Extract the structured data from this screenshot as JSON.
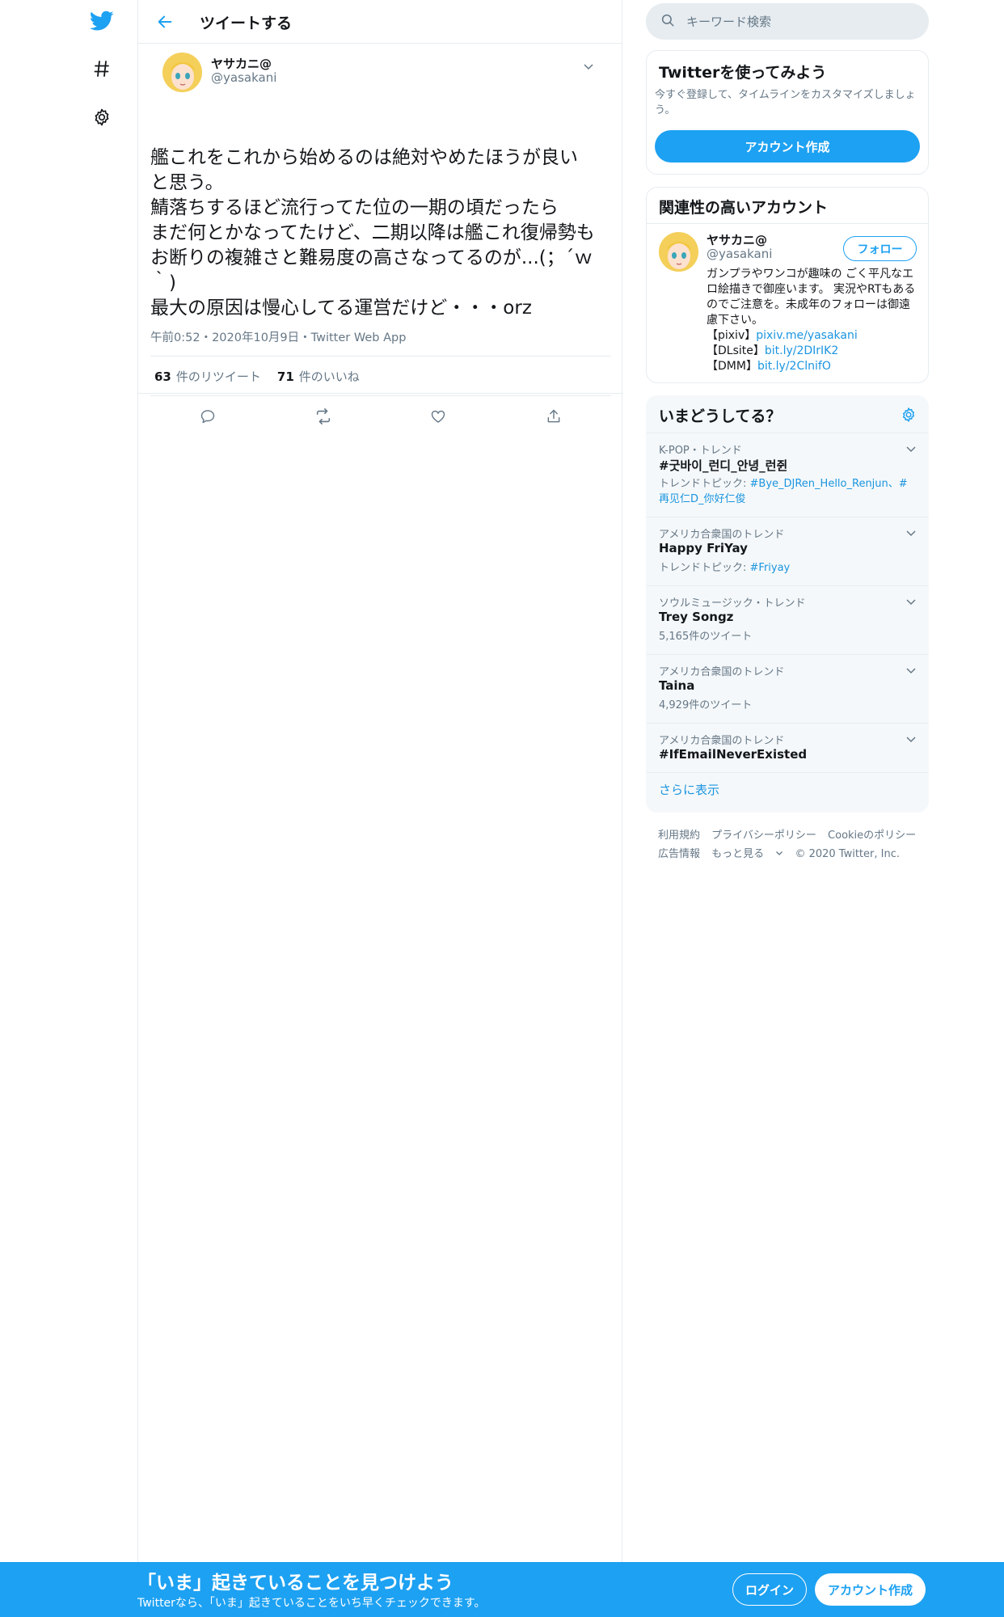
{
  "header": {
    "title": "ツイートする"
  },
  "tweet": {
    "author_name": "ヤサカニ@",
    "author_handle": "@yasakani",
    "lines": [
      "艦これをこれから始めるのは絶対やめたほうが良い",
      "と思う。",
      "鯖落ちするほど流行ってた位の一期の頃だったら",
      "まだ何とかなってたけど、二期以降は艦これ復帰勢も",
      "お断りの複雑さと難易度の高さなってるのが...(；´ｗ",
      "｀)",
      "最大の原因は慢心してる運営だけど・・・orz"
    ],
    "time": "午前0:52",
    "date": "2020年10月9日",
    "source": "Twitter Web App",
    "retweet_count": "63",
    "retweet_label": "件のリツイート",
    "like_count": "71",
    "like_label": "件のいいね"
  },
  "search": {
    "placeholder": "キーワード検索"
  },
  "signup": {
    "title": "Twitterを使ってみよう",
    "description": "今すぐ登録して、タイムラインをカスタマイズしましょう。",
    "button": "アカウント作成"
  },
  "related": {
    "title": "関連性の高いアカウント",
    "name": "ヤサカニ@",
    "handle": "@yasakani",
    "follow_label": "フォロー",
    "bio_text": "ガンプラやワンコが趣味の ごく平凡なエロ絵描きで御座います。 実況やRTもあるのでご注意を。未成年のフォローは御遠慮下さい。",
    "pixiv_label": "【pixiv】",
    "pixiv_link": "pixiv.me/yasakani",
    "dlsite_label": "【DLsite】",
    "dlsite_link": "bit.ly/2DIrIK2",
    "dmm_label": "【DMM】",
    "dmm_link": "bit.ly/2ClnifO"
  },
  "trends": {
    "title": "いまどうしてる？",
    "items": [
      {
        "context": "K-POP・トレンド",
        "name": "#굿바이_런디_안녕_런쥔",
        "sub_prefix": "トレンドトピック: ",
        "sub_links": "#Bye_DJRen_Hello_Renjun、#再见仁D_你好仁俊"
      },
      {
        "context": "アメリカ合衆国のトレンド",
        "name": "Happy FriYay",
        "sub_prefix": "トレンドトピック: ",
        "sub_links": "#Friyay"
      },
      {
        "context": "ソウルミュージック・トレンド",
        "name": "Trey Songz",
        "sub_prefix": "5,165件のツイート",
        "sub_links": ""
      },
      {
        "context": "アメリカ合衆国のトレンド",
        "name": "Taina",
        "sub_prefix": "4,929件のツイート",
        "sub_links": ""
      },
      {
        "context": "アメリカ合衆国のトレンド",
        "name": "#IfEmailNeverExisted",
        "sub_prefix": "",
        "sub_links": ""
      }
    ],
    "show_more": "さらに表示"
  },
  "footer": {
    "terms": "利用規約",
    "privacy": "プライバシーポリシー",
    "cookie": "Cookieのポリシー",
    "ads": "広告情報",
    "more": "もっと見る",
    "copyright": "© 2020 Twitter, Inc."
  },
  "banner": {
    "title": "「いま」起きていることを見つけよう",
    "subtitle": "Twitterなら、「いま」起きていることをいち早くチェックできます。",
    "login": "ログイン",
    "signup": "アカウント作成"
  },
  "colors": {
    "accent": "#1da1f2",
    "link": "#1b95e0",
    "muted": "#657786",
    "border": "#e6ecf0"
  }
}
